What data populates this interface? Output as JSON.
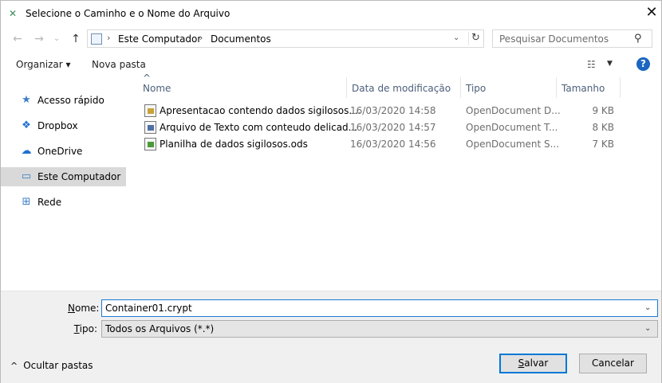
{
  "window": {
    "title": "Selecione o Caminho e o Nome do Arquivo",
    "close_glyph": "✕",
    "app_icon_glyph": "✕"
  },
  "nav": {
    "back_glyph": "←",
    "forward_glyph": "→",
    "history_glyph": "⌄",
    "up_glyph": "↑",
    "breadcrumb": [
      "Este Computador",
      "Documentos"
    ],
    "separator": "›",
    "address_dropdown_glyph": "⌄",
    "refresh_glyph": "↻",
    "search_placeholder": "Pesquisar Documentos",
    "search_glyph": "⚲"
  },
  "toolbar": {
    "organize_label": "Organizar ▾",
    "new_folder_label": "Nova pasta",
    "view_glyph": "☷",
    "view_dropdown_glyph": "▼",
    "help_glyph": "?"
  },
  "sidebar": {
    "items": [
      {
        "label": "Acesso rápido",
        "icon": "star-icon",
        "glyph": "★",
        "color": "#3c7dc4"
      },
      {
        "label": "Dropbox",
        "icon": "dropbox-icon",
        "glyph": "❖",
        "color": "#1e6fd1"
      },
      {
        "label": "OneDrive",
        "icon": "cloud-icon",
        "glyph": "☁",
        "color": "#1e6fd1"
      },
      {
        "label": "Este Computador",
        "icon": "computer-icon",
        "glyph": "▭",
        "color": "#2f7fc8"
      },
      {
        "label": "Rede",
        "icon": "network-icon",
        "glyph": "⊞",
        "color": "#3c7dc4"
      }
    ]
  },
  "files": {
    "columns": [
      "Nome",
      "Data de modificação",
      "Tipo",
      "Tamanho"
    ],
    "sort_glyph": "^",
    "rows": [
      {
        "name": "Apresentacao contendo dados sigilosos....",
        "date": "16/03/2020 14:58",
        "type": "OpenDocument D...",
        "size": "9 KB",
        "kind": "presentation"
      },
      {
        "name": "Arquivo de Texto com conteudo delicad...",
        "date": "16/03/2020 14:57",
        "type": "OpenDocument T...",
        "size": "8 KB",
        "kind": "text"
      },
      {
        "name": "Planilha de dados sigilosos.ods",
        "date": "16/03/2020 14:56",
        "type": "OpenDocument S...",
        "size": "7 KB",
        "kind": "sheet"
      }
    ]
  },
  "footer": {
    "name_label_u": "N",
    "name_label_rest": "ome:",
    "name_value": "Container01.crypt",
    "type_label_u": "T",
    "type_label_rest": "ipo:",
    "type_value": "Todos os Arquivos (*.*)",
    "dropdown_glyph": "⌄",
    "hide_folders_glyph": "^",
    "hide_folders_label": "Ocultar pastas",
    "save_label_u": "S",
    "save_label_rest": "alvar",
    "cancel_label": "Cancelar"
  }
}
